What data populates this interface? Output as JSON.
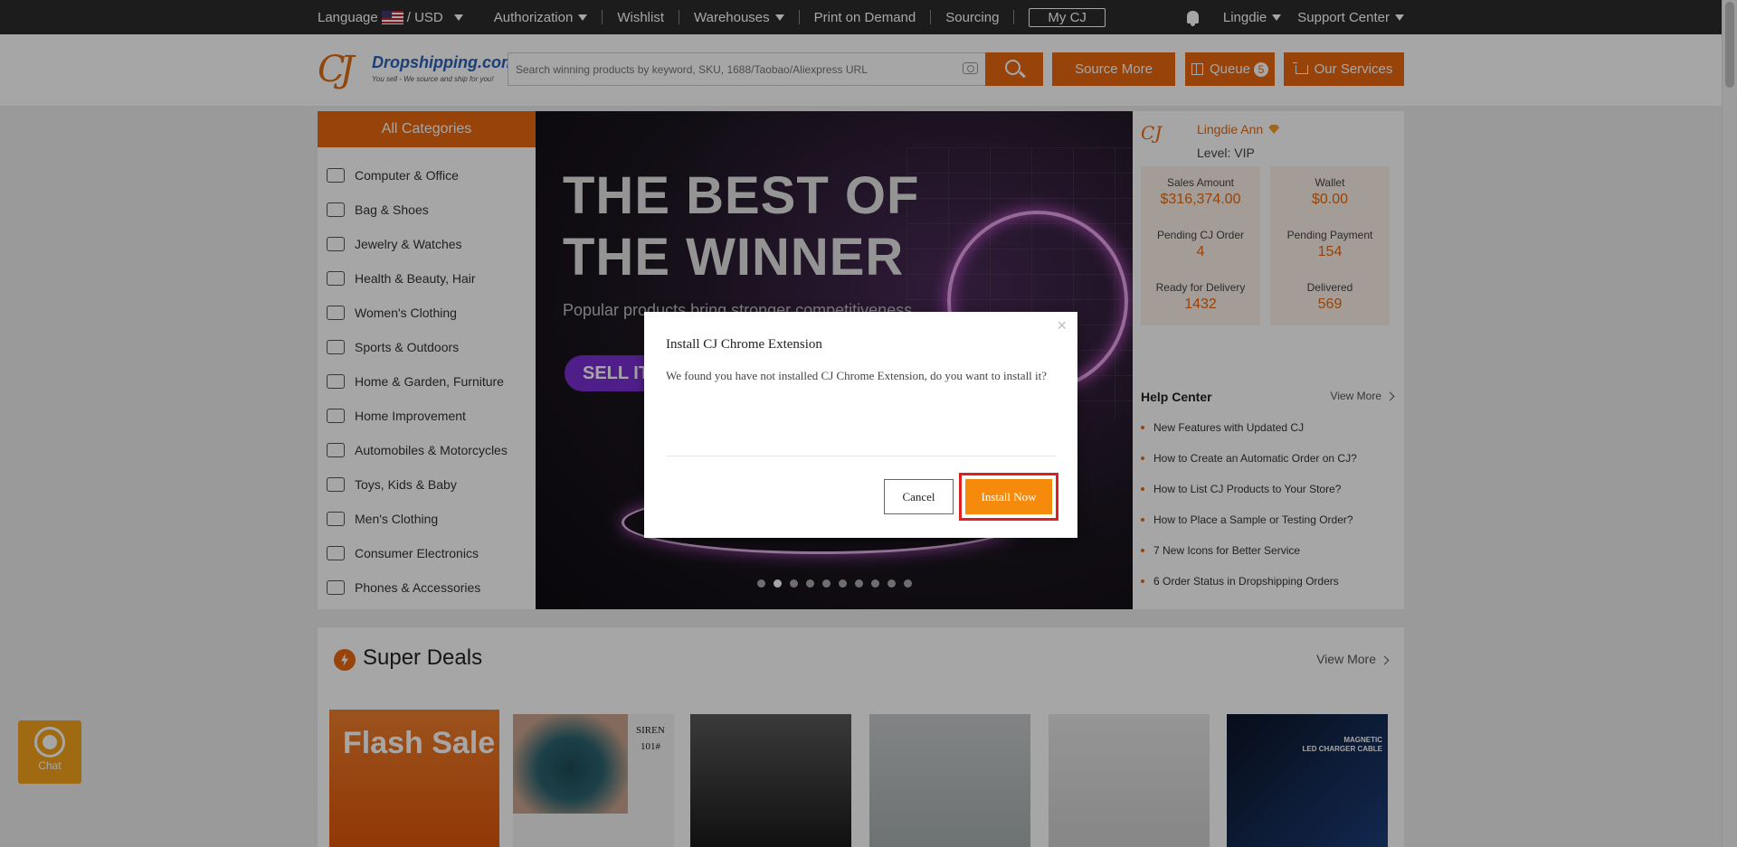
{
  "topnav": {
    "language_label": "Language",
    "currency": "/ USD",
    "authorization": "Authorization",
    "wishlist": "Wishlist",
    "warehouses": "Warehouses",
    "print_on_demand": "Print on Demand",
    "sourcing": "Sourcing",
    "my_cj": "My CJ",
    "username": "Lingdie",
    "support": "Support Center"
  },
  "header": {
    "logo_mark": "CJ",
    "logo_brand": "Dropshipping.com",
    "logo_tagline": "You sell - We source and ship for you!",
    "search_placeholder": "Search winning products by keyword, SKU, 1688/Taobao/Aliexpress URL",
    "source_more": "Source More",
    "queue_label": "Queue",
    "queue_count": "5",
    "our_services": "Our Services"
  },
  "categories": {
    "title": "All Categories",
    "items": [
      {
        "label": "Computer & Office"
      },
      {
        "label": "Bag & Shoes"
      },
      {
        "label": "Jewelry & Watches"
      },
      {
        "label": "Health & Beauty, Hair"
      },
      {
        "label": "Women's Clothing"
      },
      {
        "label": "Sports & Outdoors"
      },
      {
        "label": "Home & Garden, Furniture"
      },
      {
        "label": "Home Improvement"
      },
      {
        "label": "Automobiles & Motorcycles"
      },
      {
        "label": "Toys, Kids & Baby"
      },
      {
        "label": "Men's Clothing"
      },
      {
        "label": "Consumer Electronics"
      },
      {
        "label": "Phones & Accessories"
      }
    ]
  },
  "banner": {
    "line1": "THE BEST OF",
    "line2": "THE WINNER",
    "subtitle": "Popular products bring stronger competitiveness",
    "cta": "SELL IT",
    "slide_count": 10,
    "active_slide": 2
  },
  "user": {
    "name": "Lingdie Ann",
    "level": "Level: VIP",
    "stats": [
      {
        "label": "Sales Amount",
        "value": "$316,374.00"
      },
      {
        "label": "Wallet",
        "value": "$0.00"
      },
      {
        "label": "Pending CJ Order",
        "value": "4"
      },
      {
        "label": "Pending Payment",
        "value": "154"
      },
      {
        "label": "Ready for Delivery",
        "value": "1432"
      },
      {
        "label": "Delivered",
        "value": "569"
      }
    ]
  },
  "help": {
    "title": "Help Center",
    "view_more": "View More",
    "items": [
      "New Features with Updated CJ",
      "How to Create an Automatic Order on CJ?",
      "How to List CJ Products to Your Store?",
      "How to Place a Sample or Testing Order?",
      "7 New Icons for Better Service",
      "6 Order Status in Dropshipping Orders"
    ]
  },
  "deals": {
    "title": "Super Deals",
    "view_more": "View More",
    "flash": "Flash Sale",
    "lipstick_brand": "SIREN",
    "lipstick_shade": "101#",
    "cable_caption_1": "MAGNETIC",
    "cable_caption_2": "LED CHARGER CABLE"
  },
  "modal": {
    "title": "Install CJ Chrome Extension",
    "message": "We found you have not installed CJ Chrome Extension, do you want to install it?",
    "cancel": "Cancel",
    "install": "Install Now",
    "close": "×"
  },
  "chat": {
    "label": "Chat"
  },
  "colors": {
    "accent": "#e8680f",
    "topbar": "#2b2b2b",
    "install": "#f58a0b",
    "highlight": "#e02020"
  }
}
